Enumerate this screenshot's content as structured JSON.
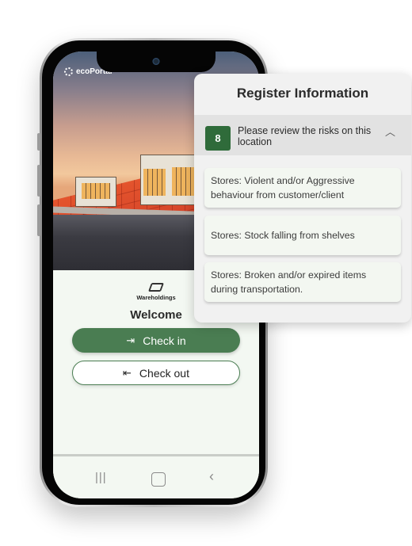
{
  "app": {
    "logo_text": "ecoPortal",
    "brand_name": "Wareholdings",
    "welcome": "Welcome",
    "checkin_label": "Check in",
    "checkout_label": "Check out",
    "nav": {
      "recent": "|||",
      "back": "‹"
    }
  },
  "register": {
    "title": "Register Information",
    "risk_count": "8",
    "risk_prompt": "Please review the risks on this location",
    "risks": [
      "Stores: Violent and/or Aggressive behaviour from customer/client",
      "Stores: Stock falling from shelves",
      "Stores: Broken and/or expired items during transportation."
    ]
  },
  "colors": {
    "accent": "#4a7d52",
    "badge": "#2f6b3a"
  }
}
